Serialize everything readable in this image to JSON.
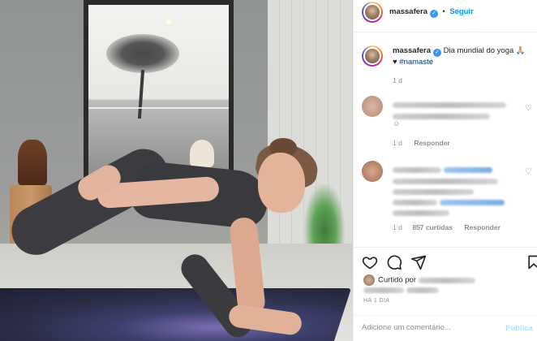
{
  "post": {
    "author": "massafera",
    "follow_label": "Seguir",
    "caption_text": "Dia mundial do yoga 🙏🏼",
    "caption_hashtag": "#namaste",
    "caption_age": "1 d",
    "likes_prefix": "Curtido por",
    "timestamp": "HÁ 1 DIA",
    "comment_placeholder": "Adicione um comentário...",
    "publish_label": "Publica"
  },
  "comments": [
    {
      "age": "1 d",
      "reply_label": "Responder"
    },
    {
      "age": "1 d",
      "likes": "857 curtidas",
      "reply_label": "Responder"
    }
  ],
  "colors": {
    "accent": "#0095f6",
    "verified": "#3897f0",
    "hashtag": "#00376b",
    "muted": "#8e8e8e"
  },
  "icons": [
    "verified-icon",
    "more-icon",
    "heart-icon",
    "comment-icon",
    "share-icon",
    "save-icon",
    "small-heart-icon"
  ]
}
